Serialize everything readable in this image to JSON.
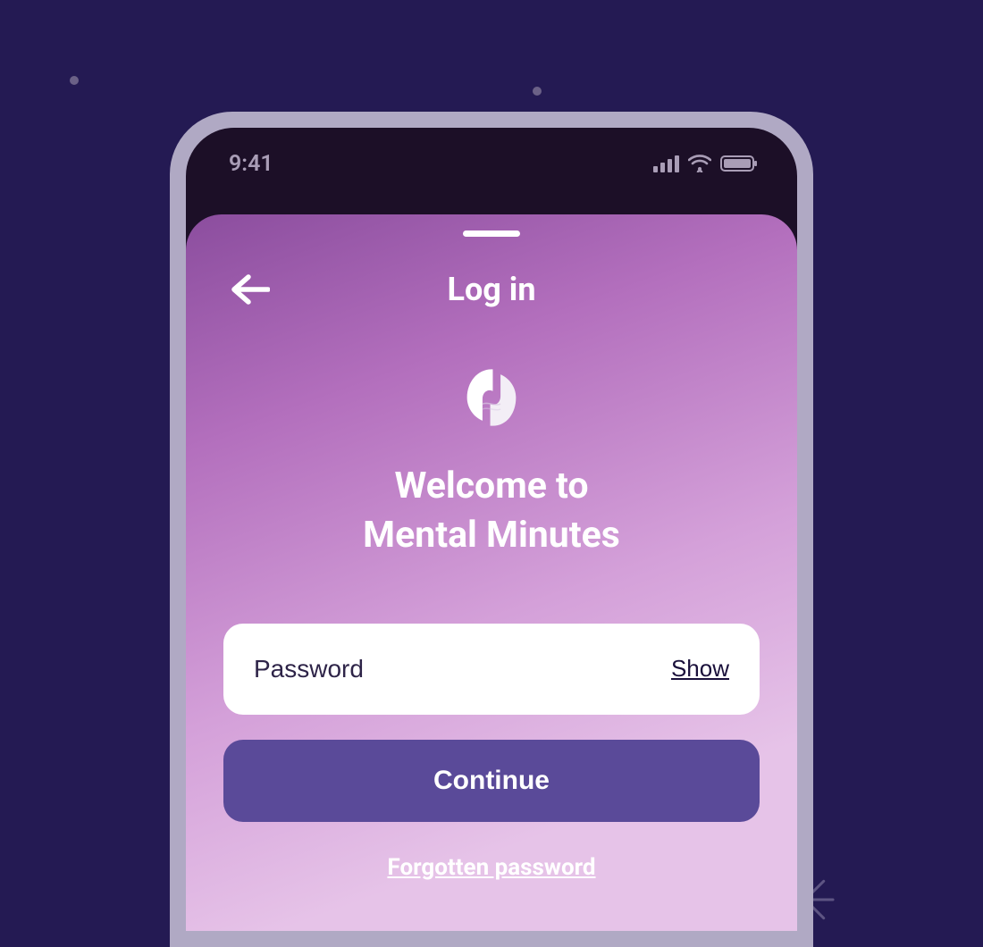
{
  "statusbar": {
    "time": "9:41"
  },
  "sheet": {
    "title": "Log in",
    "welcome_line1": "Welcome to",
    "welcome_line2": "Mental Minutes"
  },
  "form": {
    "password_placeholder": "Password",
    "show_label": "Show",
    "continue_label": "Continue",
    "forgotten_label": "Forgotten password"
  }
}
